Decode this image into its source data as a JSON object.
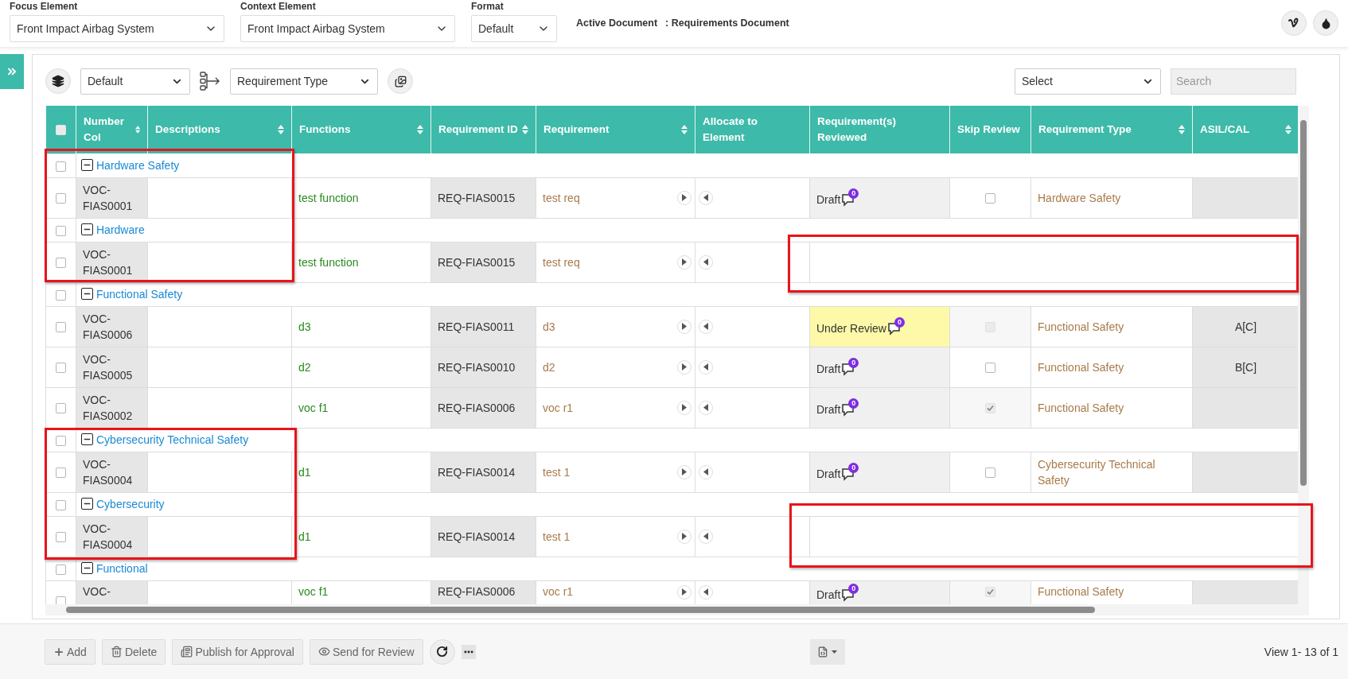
{
  "top_bar": {
    "fields": [
      {
        "label": "Focus Element",
        "value": "Front Impact Airbag System",
        "kind": "wide"
      },
      {
        "label": "Context Element",
        "value": "Front Impact Airbag System",
        "kind": "wide"
      },
      {
        "label": "Format",
        "value": "Default",
        "kind": "narrow"
      }
    ],
    "active_document": {
      "label": "Active Document",
      "value": ": Requirements Document"
    }
  },
  "toolbar": {
    "view_select": "Default",
    "group_select": "Requirement Type",
    "filter_select": "Select",
    "search": {
      "placeholder": "Search"
    }
  },
  "table": {
    "select_all": {
      "checked": false
    },
    "columns": [
      {
        "label": "Number Col",
        "sortable": true
      },
      {
        "label": "Descriptions",
        "sortable": true
      },
      {
        "label": "Functions",
        "sortable": true
      },
      {
        "label": "Requirement ID",
        "sortable": true
      },
      {
        "label": "Requirement",
        "sortable": true
      },
      {
        "label": "Allocate to Element",
        "sortable": false
      },
      {
        "label": "Requirement(s) Reviewed",
        "sortable": false
      },
      {
        "label": "Skip Review",
        "sortable": false
      },
      {
        "label": "Requirement Type",
        "sortable": true
      },
      {
        "label": "ASIL/CAL",
        "sortable": true
      }
    ],
    "rows": [
      {
        "kind": "group",
        "checked": false,
        "label": "Hardware Safety",
        "expanded": true
      },
      {
        "kind": "item",
        "checked": false,
        "number": "VOC-FIAS0001",
        "function": "test function",
        "requirement_id": "REQ-FIAS0015",
        "requirement": "test req",
        "review": {
          "status": "Draft",
          "comments": "0",
          "highlighted": false
        },
        "skip_review": {
          "checked": false,
          "disabled": false
        },
        "requirement_type": "Hardware Safety"
      },
      {
        "kind": "group",
        "checked": false,
        "label": "Hardware",
        "expanded": true
      },
      {
        "kind": "item",
        "checked": false,
        "number": "VOC-FIAS0001",
        "function": "test function",
        "requirement_id": "REQ-FIAS0015",
        "requirement": "test req"
      },
      {
        "kind": "group",
        "checked": false,
        "label": "Functional Safety",
        "expanded": true
      },
      {
        "kind": "item",
        "checked": false,
        "number": "VOC-FIAS0006",
        "function": "d3",
        "requirement_id": "REQ-FIAS0011",
        "requirement": "d3",
        "review": {
          "status": "Under Review",
          "comments": "0",
          "highlighted": true
        },
        "skip_review": {
          "checked": false,
          "disabled": true
        },
        "requirement_type": "Functional Safety",
        "asil": "A[C]"
      },
      {
        "kind": "item",
        "checked": false,
        "number": "VOC-FIAS0005",
        "function": "d2",
        "requirement_id": "REQ-FIAS0010",
        "requirement": "d2",
        "review": {
          "status": "Draft",
          "comments": "0",
          "highlighted": false
        },
        "skip_review": {
          "checked": false,
          "disabled": false
        },
        "requirement_type": "Functional Safety",
        "asil": "B[C]"
      },
      {
        "kind": "item",
        "checked": false,
        "number": "VOC-FIAS0002",
        "function": "voc f1",
        "requirement_id": "REQ-FIAS0006",
        "requirement": "voc r1",
        "review": {
          "status": "Draft",
          "comments": "0",
          "highlighted": false
        },
        "skip_review": {
          "checked": true,
          "disabled": true
        },
        "requirement_type": "Functional Safety"
      },
      {
        "kind": "group",
        "checked": false,
        "label": "Cybersecurity Technical Safety",
        "expanded": true
      },
      {
        "kind": "item",
        "checked": false,
        "number": "VOC-FIAS0004",
        "function": "d1",
        "requirement_id": "REQ-FIAS0014",
        "requirement": "test 1",
        "review": {
          "status": "Draft",
          "comments": "0",
          "highlighted": false
        },
        "skip_review": {
          "checked": false,
          "disabled": false
        },
        "requirement_type": "Cybersecurity Technical Safety"
      },
      {
        "kind": "group",
        "checked": false,
        "label": "Cybersecurity",
        "expanded": true
      },
      {
        "kind": "item",
        "checked": false,
        "number": "VOC-FIAS0004",
        "function": "d1",
        "requirement_id": "REQ-FIAS0014",
        "requirement": "test 1"
      },
      {
        "kind": "group",
        "checked": false,
        "label": "Functional",
        "expanded": true
      },
      {
        "kind": "item",
        "checked": false,
        "number": "VOC-",
        "function": "voc f1",
        "requirement_id": "REQ-FIAS0006",
        "requirement": "voc r1",
        "review": {
          "status": "Draft",
          "comments": "0",
          "highlighted": false
        },
        "skip_review": {
          "checked": true,
          "disabled": true
        },
        "requirement_type": "Functional Safety"
      }
    ]
  },
  "annotation_frames": [
    {
      "kind": "box"
    },
    {
      "kind": "box"
    },
    {
      "kind": "box"
    },
    {
      "kind": "box"
    }
  ],
  "footer": {
    "buttons": [
      {
        "label": "Add",
        "kind": "add"
      },
      {
        "label": "Delete",
        "kind": "delete"
      },
      {
        "label": "Publish for Approval",
        "kind": "publish"
      },
      {
        "label": "Send for Review",
        "kind": "review"
      }
    ],
    "pager": "View 1- 13 of 1"
  }
}
